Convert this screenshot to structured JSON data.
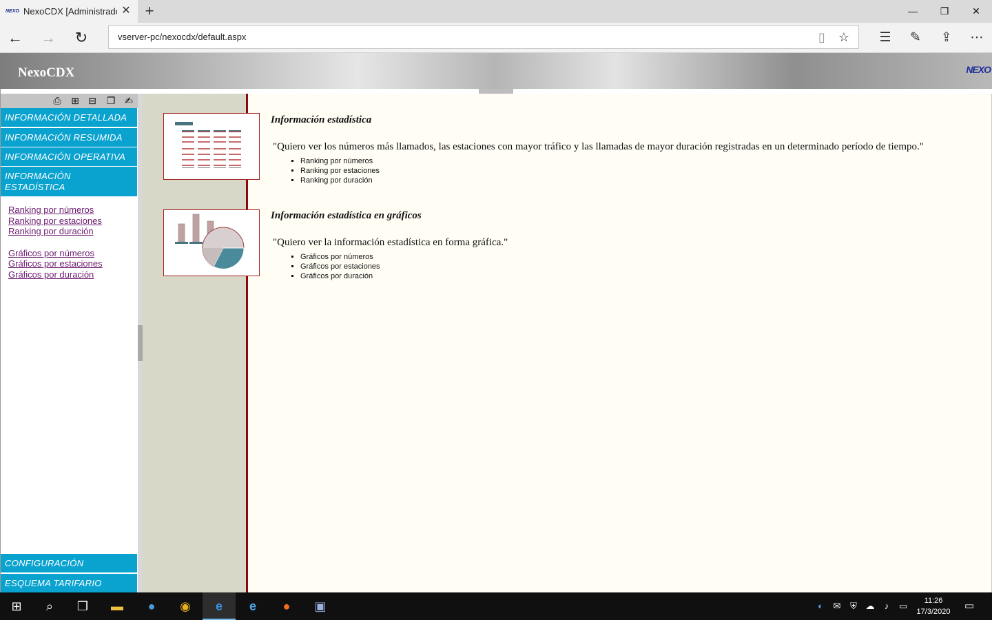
{
  "browser": {
    "tab_title": "NexoCDX [Administrador]",
    "tab_favicon": "NEXO",
    "url": "vserver-pc/nexocdx/default.aspx",
    "icons": {
      "back": "back-arrow-icon",
      "forward": "forward-arrow-icon",
      "refresh": "refresh-icon",
      "reading": "reading-view-icon",
      "favorite": "star-icon",
      "hub": "hub-icon",
      "notes": "web-note-icon",
      "share": "share-icon",
      "more": "more-icon"
    }
  },
  "app": {
    "title": "NexoCDX",
    "logo": "NEXO",
    "accent_color": "#0aa3cf",
    "rule_color": "#8c0a0a"
  },
  "menu": {
    "top_items": [
      "INFORMACIÓN DETALLADA",
      "INFORMACIÓN RESUMIDA",
      "INFORMACIÓN OPERATIVA",
      "INFORMACIÓN ESTADÍSTICA"
    ],
    "links": [
      "Ranking por números",
      "Ranking por estaciones",
      "Ranking por duración",
      "Gráficos por números",
      "Gráficos por estaciones",
      "Gráficos por duración"
    ],
    "bottom_items": [
      "CONFIGURACIÓN",
      "ESQUEMA TARIFARIO"
    ]
  },
  "sections": [
    {
      "title": "Información estadística",
      "quote": "\"Quiero ver los números más llamados, las estaciones con mayor tráfico y las llamadas de mayor duración registradas en un determinado período de tiempo.\"",
      "items": [
        "Ranking por números",
        "Ranking por estaciones",
        "Ranking por duración"
      ]
    },
    {
      "title": "Información estadística en gráficos",
      "quote": "\"Quiero ver la información estadística en forma gráfica.\"",
      "items": [
        "Gráficos por números",
        "Gráficos por estaciones",
        "Gráficos por duración"
      ]
    }
  ],
  "taskbar": {
    "time": "11:26",
    "date": "17/3/2020"
  }
}
